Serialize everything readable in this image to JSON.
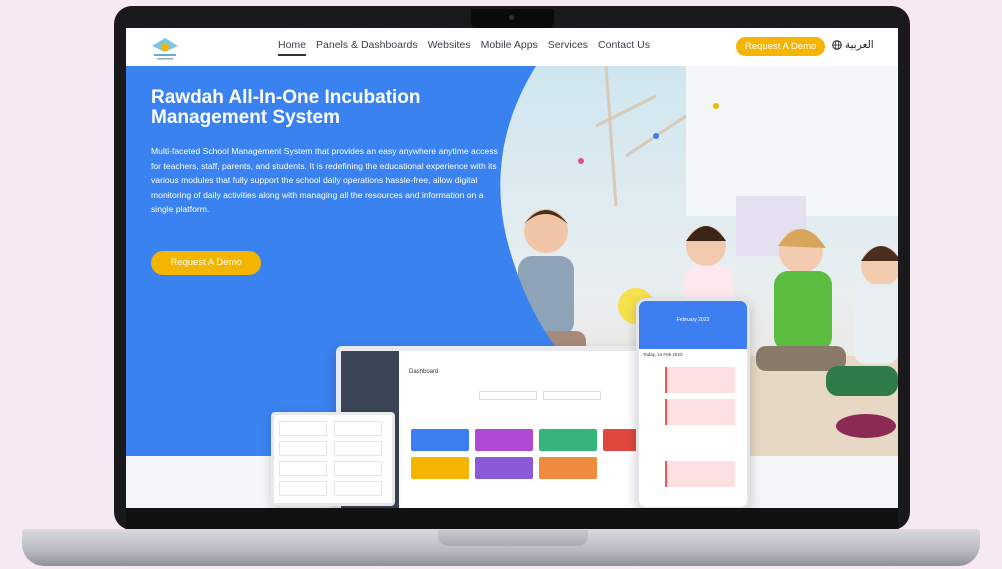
{
  "nav": {
    "links": [
      "Home",
      "Panels & Dashboards",
      "Websites",
      "Mobile Apps",
      "Services",
      "Contact Us"
    ],
    "active_link": "Home",
    "demo_button": "Request A Demo",
    "language": "العربية"
  },
  "hero": {
    "title_line1": "Rawdah All-In-One Incubation",
    "title_line2": "Management System",
    "description": "Multi-faceted School Management System that provides an easy anywhere anytime access for teachers, staff, parents, and students. It is redefining the educational experience with its various modules that fully support the school daily operations hassle-free, allow digital monitoring of daily activities along with managing all the resources and information on a single platform.",
    "cta_button": "Request A Demo"
  },
  "dashboard": {
    "title": "Dashboard"
  },
  "phone": {
    "month": "February 2023",
    "date_label": "Today, 14 Feb 2023"
  },
  "colors": {
    "hero_blue": "#3a82f0",
    "accent_yellow": "#f4b500"
  }
}
